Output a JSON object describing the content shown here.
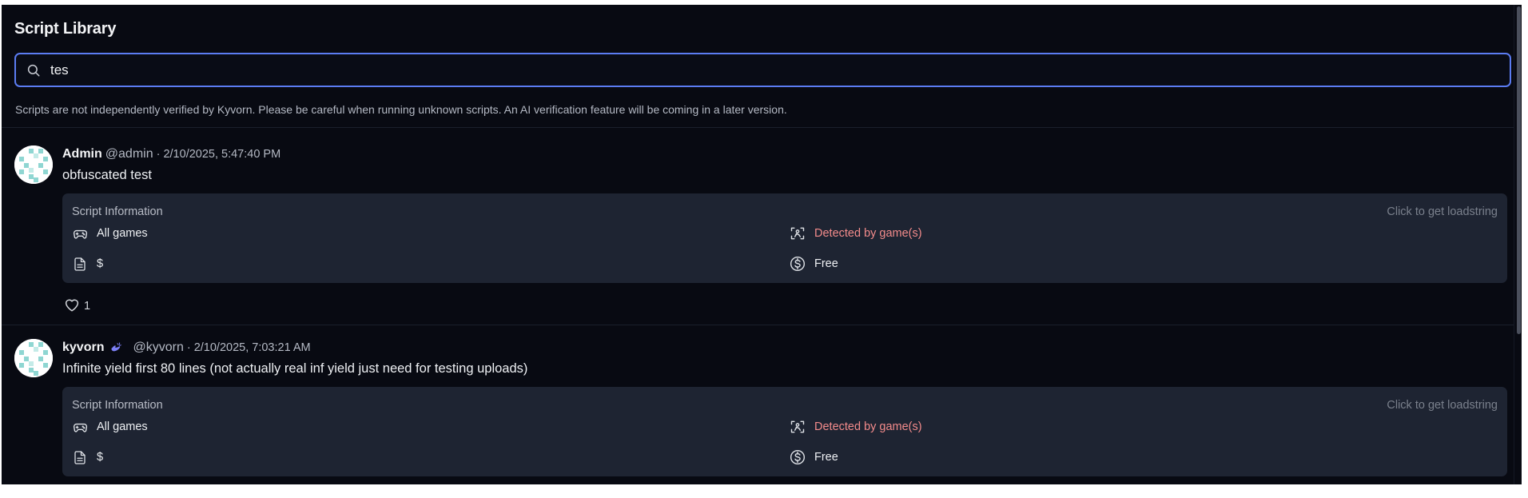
{
  "page": {
    "title": "Script Library",
    "search": {
      "value": "tes",
      "placeholder": ""
    },
    "disclaimer": "Scripts are not independently verified by Kyvorn. Please be careful when running unknown scripts. An AI verification feature will be coming in a later version."
  },
  "posts": [
    {
      "author": "Admin",
      "handle": "@admin",
      "meta": "· 2/10/2025, 5:47:40 PM",
      "verified": false,
      "title": "obfuscated test",
      "info": {
        "label": "Script Information",
        "loadstring": "Click to get loadstring",
        "games": "All games",
        "detection": "Detected by game(s)",
        "key": "$",
        "price": "Free"
      },
      "likes": "1"
    },
    {
      "author": "kyvorn",
      "handle": "@kyvorn",
      "meta": "· 2/10/2025, 7:03:21 AM",
      "verified": true,
      "title": "Infinite yield first 80 lines (not actually real inf yield just need for testing uploads)",
      "info": {
        "label": "Script Information",
        "loadstring": "Click to get loadstring",
        "games": "All games",
        "detection": "Detected by game(s)",
        "key": "$",
        "price": "Free"
      },
      "likes": ""
    }
  ],
  "icons": {
    "search": "search-icon",
    "games": "gamepad-icon",
    "detection": "detected-scan-icon",
    "key": "document-icon",
    "price": "dollar-circle-icon",
    "like": "heart-icon",
    "verified": "verified-badge-icon"
  },
  "colors": {
    "background": "#080a12",
    "card": "#1e2432",
    "accent": "#5b7cf2",
    "danger_text": "#f38b8b",
    "avatar_pattern": "#8fd6d2"
  }
}
